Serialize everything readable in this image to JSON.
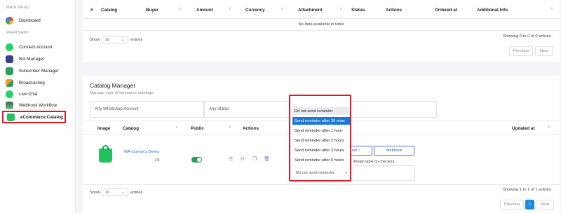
{
  "sidebar": {
    "main_menu_label": "MAIN MENU",
    "dashboard": "Dashboard",
    "whatsapp_label": "WHATSAPP",
    "items": [
      {
        "label": "Connect Account",
        "icon": "whatsapp-icon",
        "color": "#25d366"
      },
      {
        "label": "Bot Manager",
        "icon": "robot-icon",
        "color": "#3a3f8f"
      },
      {
        "label": "Subscriber Manager",
        "icon": "subscribers-icon",
        "color": "#2e9d5b"
      },
      {
        "label": "Broadcasting",
        "icon": "broadcast-icon",
        "color": "#f0a020"
      },
      {
        "label": "Live Chat",
        "icon": "whatsapp-chat-icon",
        "color": "#25d366"
      },
      {
        "label": "Webhook Workflow",
        "icon": "webhook-icon",
        "color": "#2a6a4a"
      },
      {
        "label": "eCommerce Catalog",
        "icon": "shopping-bag-icon",
        "color": "#22c15e"
      }
    ]
  },
  "orders_table": {
    "headers": [
      "#",
      "Catalog",
      "Buyer",
      "Amount",
      "Currency",
      "Attachment",
      "Status",
      "Actions",
      "Ordered at",
      "Additional Info"
    ],
    "empty_message": "No data available in table",
    "info": "Showing 0 to 0 of 0 entries",
    "show_label": "Show",
    "page_size": "10",
    "entries_label": "entries",
    "prev": "Previous",
    "next": "Next"
  },
  "catalog_manager": {
    "title": "Catalog Manager",
    "subtitle": "Manage your eCommerce catalogs",
    "account_filter": "Any WhatsApp Account",
    "status_filter": "Any Status",
    "headers": {
      "image": "Image",
      "catalog": "Catalog",
      "public": "Public",
      "actions": "Actions",
      "updated_at": "Updated at"
    },
    "row": {
      "catalog_name": "WA-Connect Demo",
      "count": "15",
      "public": true
    },
    "partial_button": "ent",
    "webhook_button": "Webhook",
    "assign_label": "Assign label on checkout",
    "info": "Showing 1 to 1 of 1 entries",
    "show_label": "Show",
    "page_size": "10",
    "entries_label": "entries",
    "prev": "Previous",
    "page": "1",
    "next": "Next"
  },
  "reminder_dropdown": {
    "options": [
      "Do not send reminder",
      "Send reminder after 30 mins",
      "Send reminder after 1 hour",
      "Send reminder after 2 hours",
      "Send reminder after 3 hours",
      "Send reminder after 6 hours"
    ],
    "selected_index": 0,
    "highlighted_index": 1,
    "current_value": "Do not send reminder"
  },
  "colors": {
    "accent": "#1e88e5",
    "highlight_red": "#d71b2a",
    "toggle_on": "#2e9d5b",
    "link": "#2f6fc4"
  }
}
